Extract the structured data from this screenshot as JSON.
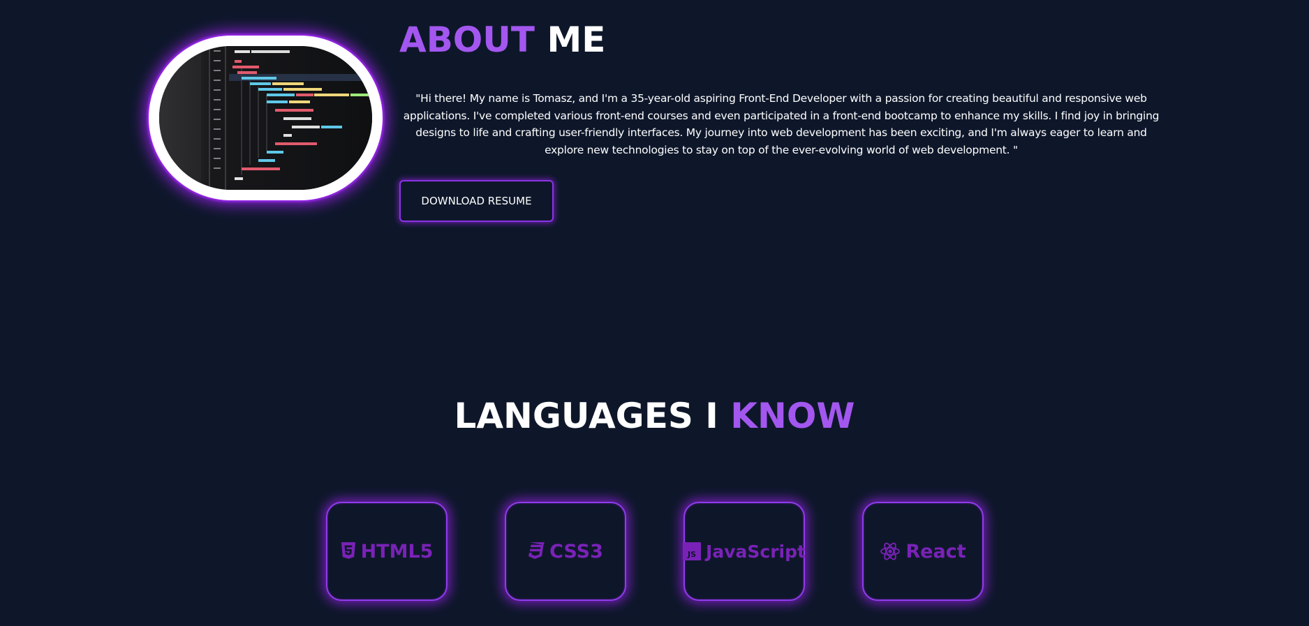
{
  "about": {
    "title_accent": "ABOUT",
    "title_rest": " ME",
    "description": "\"Hi there! My name is Tomasz, and I'm a 35-year-old aspiring Front-End Developer with a passion for creating beautiful and responsive web applications. I've completed various front-end courses and even participated in a front-end bootcamp to enhance my skills. I find joy in bringing designs to life and crafting user-friendly interfaces. My journey into web development has been exciting, and I'm always eager to learn and explore new technologies to stay on top of the ever-evolving world of web development. \"",
    "download_button_label": "DOWNLOAD RESUME"
  },
  "languages": {
    "title_rest": "LANGUAGES I ",
    "title_accent": "KNOW",
    "items": [
      {
        "label": "HTML5",
        "icon": "html5-icon"
      },
      {
        "label": "CSS3",
        "icon": "css3-icon"
      },
      {
        "label": "JavaScript",
        "icon": "javascript-icon"
      },
      {
        "label": "React",
        "icon": "react-icon"
      }
    ]
  },
  "colors": {
    "background": "#0e172a",
    "accent": "#a357ef",
    "glow": "#a824ff",
    "card_text": "#7a22b8",
    "text": "#ffffff"
  }
}
